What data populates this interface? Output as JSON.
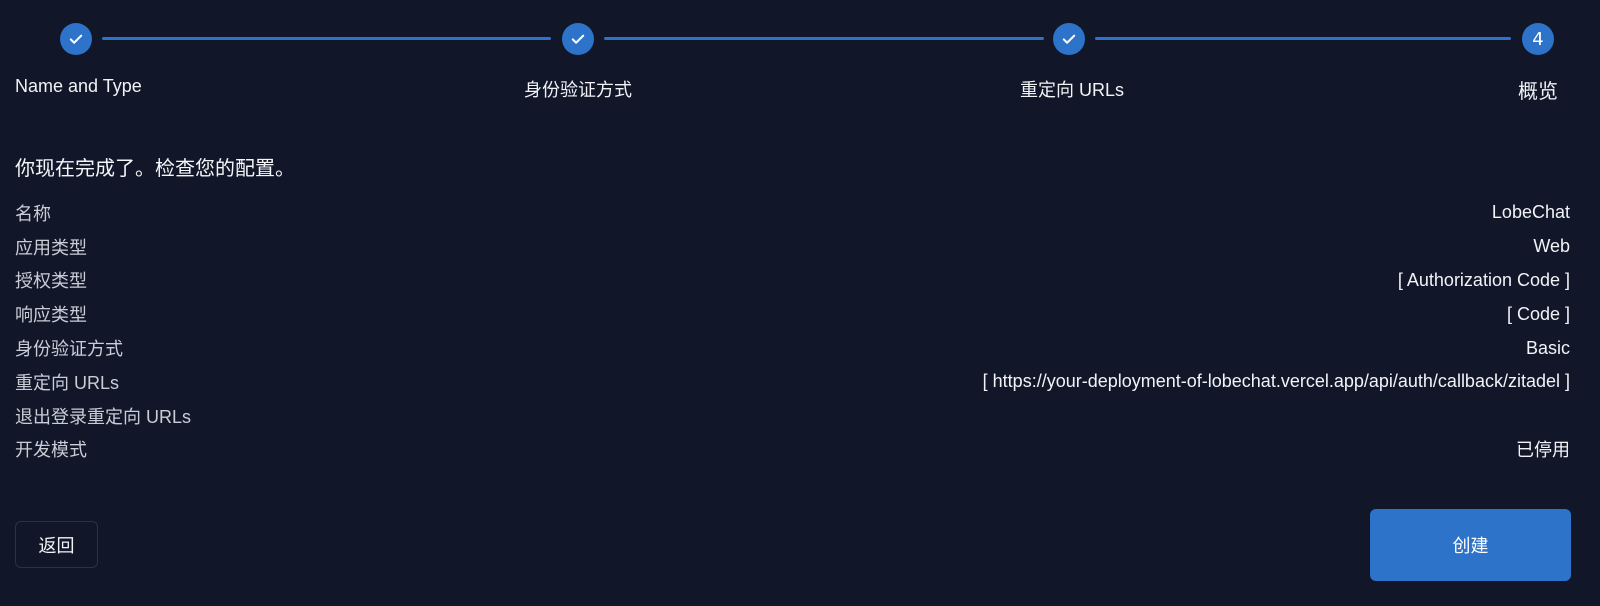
{
  "stepper": {
    "accent_color": "#2c73c9",
    "steps": [
      {
        "label": "Name and Type",
        "state": "completed",
        "marker": "check-icon"
      },
      {
        "label": "身份验证方式",
        "state": "completed",
        "marker": "check-icon"
      },
      {
        "label": "重定向 URLs",
        "state": "completed",
        "marker": "check-icon"
      },
      {
        "label": "概览",
        "state": "current",
        "number": "4"
      }
    ]
  },
  "summary": {
    "heading": "你现在完成了。检查您的配置。",
    "rows": [
      {
        "key": "名称",
        "value": "LobeChat"
      },
      {
        "key": "应用类型",
        "value": "Web"
      },
      {
        "key": "授权类型",
        "value": "[ Authorization Code ]"
      },
      {
        "key": "响应类型",
        "value": "[ Code ]"
      },
      {
        "key": "身份验证方式",
        "value": "Basic"
      },
      {
        "key": "重定向 URLs",
        "value": "[ https://your-deployment-of-lobechat.vercel.app/api/auth/callback/zitadel ]"
      },
      {
        "key": "退出登录重定向 URLs",
        "value": ""
      },
      {
        "key": "开发模式",
        "value": "已停用"
      }
    ]
  },
  "actions": {
    "back_label": "返回",
    "create_label": "创建"
  }
}
